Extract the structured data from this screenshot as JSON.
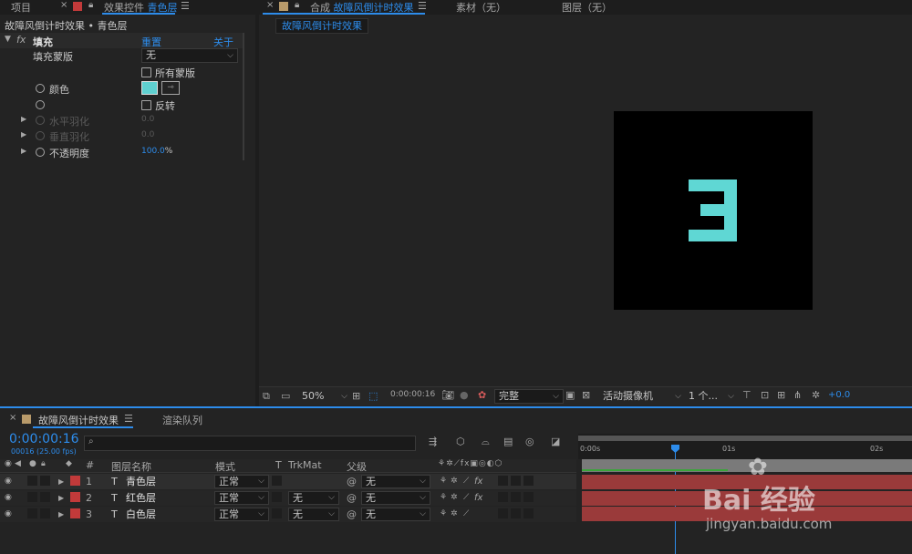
{
  "top_left_tabs": {
    "project": "项目",
    "effects_controls_prefix": "效果控件",
    "effects_controls_layer": "青色层"
  },
  "effects": {
    "breadcrumb": "故障风倒计时效果 • 青色层",
    "fx_label": "fx",
    "effect_name": "填充",
    "reset": "重置",
    "about": "关于 ...",
    "fill_mask_label": "填充蒙版",
    "fill_mask_value": "无",
    "all_masks": "所有蒙版",
    "color_label": "颜色",
    "color_value": "#5fd0d0",
    "invert": "反转",
    "h_feather": "水平羽化",
    "h_feather_val": "0.0",
    "v_feather": "垂直羽化",
    "v_feather_val": "0.0",
    "opacity": "不透明度",
    "opacity_val": "100.0",
    "opacity_unit": "%"
  },
  "comp_tabs": {
    "prefix": "合成",
    "name": "故障风倒计时效果",
    "footage": "素材（无）",
    "layer": "图层（无）",
    "subtab": "故障风倒计时效果"
  },
  "viewer": {
    "digit": "3",
    "digit_color": "#5fd7d4",
    "zoom": "50%",
    "timecode": "0:00:00:16",
    "quality": "完整",
    "camera": "活动摄像机",
    "views": "1 个...",
    "exposure": "+0.0"
  },
  "timeline_tabs": {
    "comp": "故障风倒计时效果",
    "render": "渲染队列"
  },
  "timeline": {
    "timecode": "0:00:00:16",
    "frames": "00016 (25.00 fps)",
    "search_placeholder": "",
    "headers": {
      "num": "#",
      "layer_name": "图层名称",
      "mode": "模式",
      "t": "T",
      "trkmat": "TrkMat",
      "parent": "父级"
    },
    "ruler": [
      "0:00s",
      "01s",
      "02s"
    ],
    "layers": [
      {
        "num": "1",
        "type": "T",
        "name": "青色层",
        "mode": "正常",
        "trkmat": "",
        "parent": "无",
        "label": "#c23a3a",
        "fx": "fx"
      },
      {
        "num": "2",
        "type": "T",
        "name": "红色层",
        "mode": "正常",
        "trkmat": "无",
        "parent": "无",
        "label": "#c23a3a",
        "fx": "fx"
      },
      {
        "num": "3",
        "type": "T",
        "name": "白色层",
        "mode": "正常",
        "trkmat": "无",
        "parent": "无",
        "label": "#c23a3a",
        "fx": ""
      }
    ]
  },
  "watermark": {
    "brand": "Bai 经验",
    "url": "jingyan.baidu.com"
  }
}
